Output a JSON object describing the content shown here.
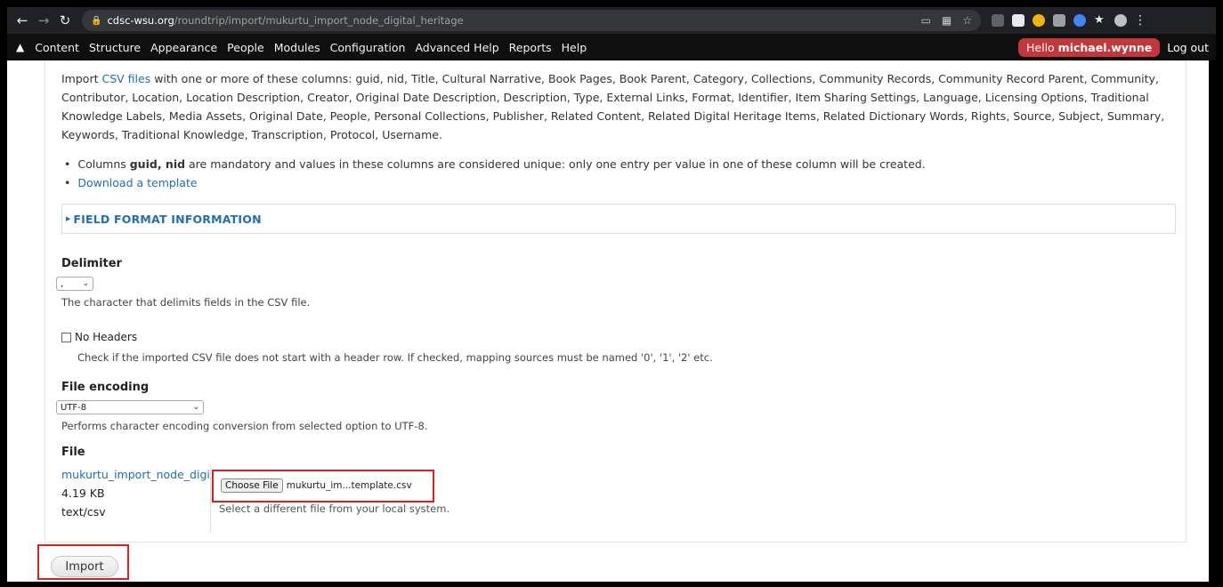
{
  "browser": {
    "url_host": "cdsc-wsu.org",
    "url_path": "/roundtrip/import/mukurtu_import_node_digital_heritage"
  },
  "admin_bar": {
    "menu": [
      "Content",
      "Structure",
      "Appearance",
      "People",
      "Modules",
      "Configuration",
      "Advanced Help",
      "Reports",
      "Help"
    ],
    "hello_prefix": "Hello ",
    "username": "michael.wynne",
    "logout": "Log out"
  },
  "intro": {
    "prefix": "Import ",
    "csv_link": "CSV files",
    "text": " with one or more of these columns: guid, nid, Title, Cultural Narrative, Book Pages, Book Parent, Category, Collections, Community Records, Community Record Parent, Community, Contributor, Location, Location Description, Creator, Original Date Description, Description, Type, External Links, Format, Identifier, Item Sharing Settings, Language, Licensing Options, Traditional Knowledge Labels, Media Assets, Original Date, People, Personal Collections, Publisher, Related Content, Related Digital Heritage Items, Related Dictionary Words, Rights, Source, Subject, Summary, Keywords, Traditional Knowledge, Transcription, Protocol, Username."
  },
  "bullets": {
    "b1_prefix": "Columns ",
    "b1_bold": "guid, nid",
    "b1_text": " are mandatory and values in these columns are considered unique: only one entry per value in one of these column will be created.",
    "template_link": "Download a template"
  },
  "field_format": {
    "legend": "FIELD FORMAT INFORMATION"
  },
  "delimiter": {
    "label": "Delimiter",
    "value": ",",
    "description": "The character that delimits fields in the CSV file."
  },
  "no_headers": {
    "label": "No Headers",
    "description": "Check if the imported CSV file does not start with a header row. If checked, mapping sources must be named '0', '1', '2' etc."
  },
  "encoding": {
    "label": "File encoding",
    "value": "UTF-8",
    "description": "Performs character encoding conversion from selected option to UTF-8."
  },
  "file": {
    "label": "File",
    "current_name": "mukurtu_import_node_digital_heritage_template.csv",
    "size": "4.19 KB",
    "mime": "text/csv",
    "choose_label": "Choose File",
    "chosen_name": "mukurtu_im...template.csv",
    "hint": "Select a different file from your local system."
  },
  "import_button": "Import"
}
